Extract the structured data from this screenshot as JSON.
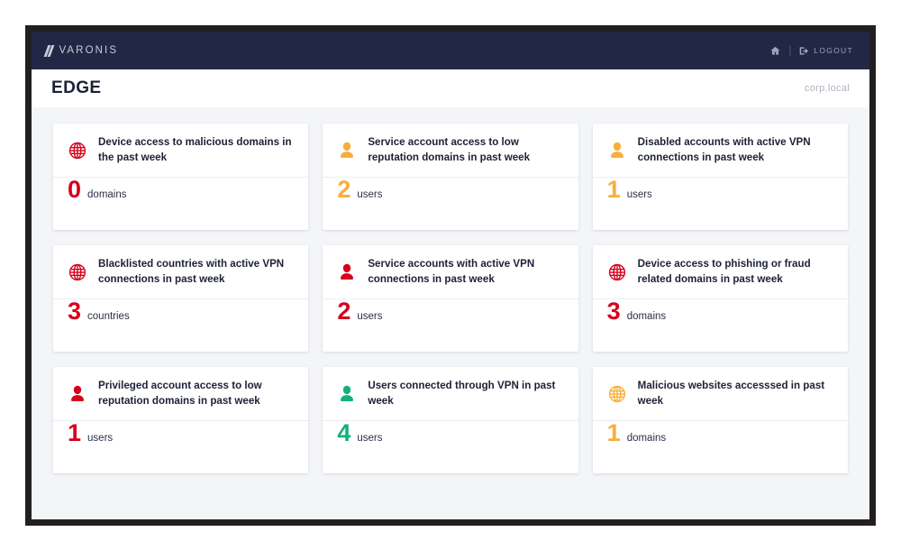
{
  "colors": {
    "navy": "#222746",
    "red": "#d6001c",
    "orange": "#f9ae3b",
    "green": "#14b07a",
    "page_bg": "#f4f5f8",
    "bezel": "#231f20"
  },
  "top_bar": {
    "brand": "VARONIS",
    "brand_icon": "varonis-slashes-logo",
    "home_icon": "home-icon",
    "divider": "|",
    "logout_icon": "logout-icon",
    "logout_label": "LOGOUT"
  },
  "title_bar": {
    "title": "EDGE",
    "tenant": "corp.local"
  },
  "cards": [
    {
      "icon": "globe-icon",
      "icon_color": "#d6001c",
      "title": "Device access to malicious domains in the past week",
      "value": "0",
      "unit": "domains",
      "value_color": "#d6001c"
    },
    {
      "icon": "user-icon",
      "icon_color": "#f9ae3b",
      "title": "Service account access to low reputation domains in past week",
      "value": "2",
      "unit": "users",
      "value_color": "#f9ae3b"
    },
    {
      "icon": "user-icon",
      "icon_color": "#f9ae3b",
      "title": "Disabled accounts with active VPN connections in past week",
      "value": "1",
      "unit": "users",
      "value_color": "#f9ae3b"
    },
    {
      "icon": "globe-icon",
      "icon_color": "#d6001c",
      "title": "Blacklisted countries with active VPN connections in past week",
      "value": "3",
      "unit": "countries",
      "value_color": "#d6001c"
    },
    {
      "icon": "user-icon",
      "icon_color": "#d6001c",
      "title": "Service accounts with active VPN connections in past week",
      "value": "2",
      "unit": "users",
      "value_color": "#d6001c"
    },
    {
      "icon": "globe-icon",
      "icon_color": "#d6001c",
      "title": "Device access to phishing or fraud related domains in past week",
      "value": "3",
      "unit": "domains",
      "value_color": "#d6001c"
    },
    {
      "icon": "user-icon",
      "icon_color": "#d6001c",
      "title": "Privileged account access to low reputation domains in past week",
      "value": "1",
      "unit": "users",
      "value_color": "#d6001c"
    },
    {
      "icon": "user-icon",
      "icon_color": "#14b07a",
      "title": "Users connected through VPN in past week",
      "value": "4",
      "unit": "users",
      "value_color": "#14b07a"
    },
    {
      "icon": "globe-icon",
      "icon_color": "#f9ae3b",
      "title": "Malicious websites accesssed in past week",
      "value": "1",
      "unit": "domains",
      "value_color": "#f9ae3b"
    }
  ]
}
